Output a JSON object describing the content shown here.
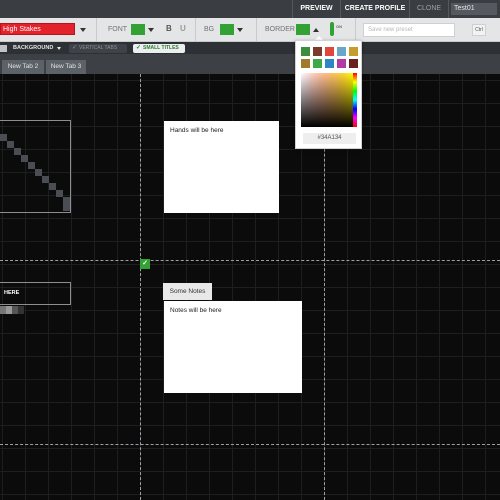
{
  "topbar": {
    "preview": "PREVIEW",
    "create_profile": "CREATE PROFILE",
    "clone": "CLONE",
    "profile_name": "Test01"
  },
  "toolbar": {
    "preset_name": "High Stakes",
    "font_label": "FONT",
    "bold": "B",
    "underline": "U",
    "bg_label": "BG",
    "border_label": "BORDER",
    "switch_state": "ON",
    "save_placeholder": "Save new preset",
    "extra_button": "Ctrl",
    "font_color": "#34A134",
    "bg_color": "#34A134",
    "border_color": "#34A134"
  },
  "subbar": {
    "background_label": "BACKGROUND",
    "vertical_tabs": "VERTICAL TABS",
    "small_titles": "SMALL TITLES"
  },
  "tabs": [
    {
      "label": "New Tab 2"
    },
    {
      "label": "New Tab 3"
    }
  ],
  "canvas": {
    "here_label": "HERE",
    "hands_text": "Hands will be here",
    "notes_tab": "Some Notes",
    "notes_text": "Notes will be here",
    "check_mark": "✓"
  },
  "color_picker": {
    "hex_value": "#34A134",
    "swatches": [
      "#3c8d3c",
      "#7b3a2e",
      "#e0463a",
      "#6aa6c8",
      "#c79b2e",
      "#a07a2a",
      "#3fa84a",
      "#2f86c4",
      "#b23aa4",
      "#6a1e1e",
      "#9fa83a"
    ]
  },
  "accent_color": "#34A134"
}
